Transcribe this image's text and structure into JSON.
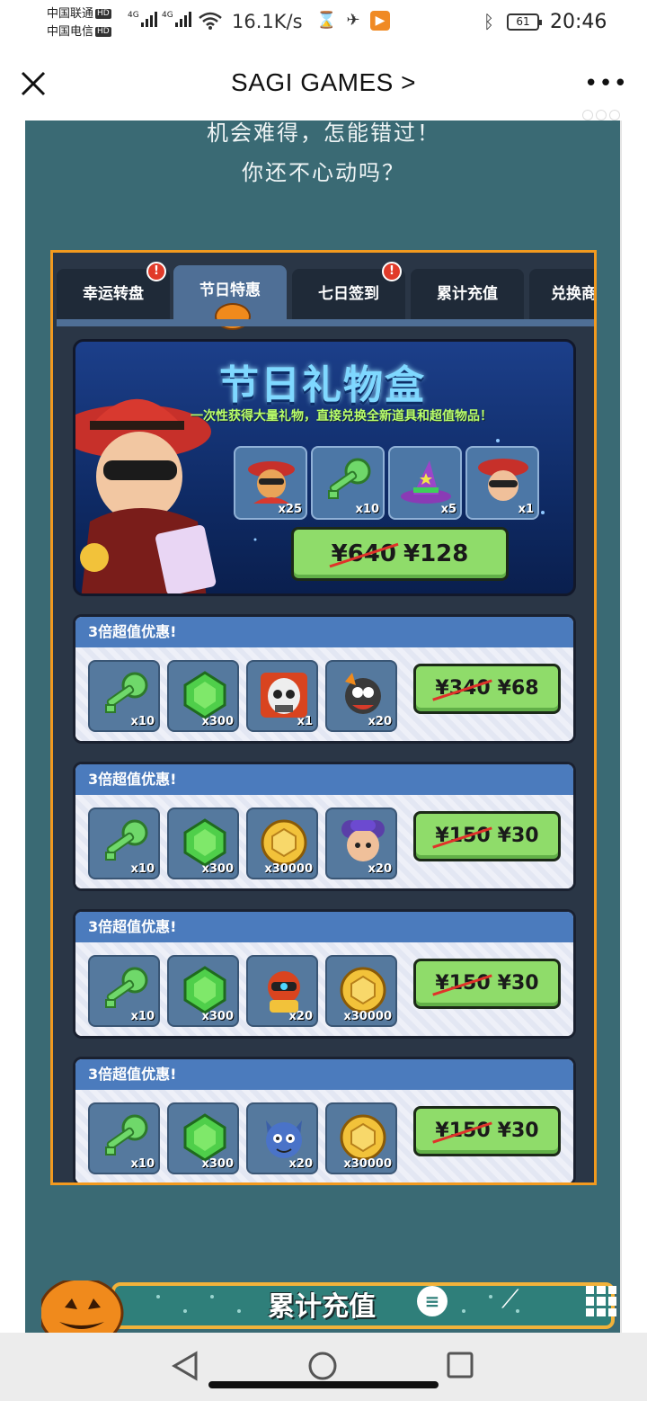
{
  "status_bar": {
    "carrier1": "中国联通",
    "carrier2": "中国电信",
    "hd": "HD",
    "net_type": "4G",
    "net_speed": "16.1K/s",
    "battery": "61",
    "time": "20:46"
  },
  "header": {
    "title": "SAGI GAMES >",
    "more": "•••"
  },
  "promo": {
    "line1": "机会难得，怎能错过！",
    "line2": "你还不心动吗？"
  },
  "tabs": [
    {
      "label": "幸运转盘",
      "badge": "!"
    },
    {
      "label": "节日特惠"
    },
    {
      "label": "七日签到",
      "badge": "!"
    },
    {
      "label": "累计充值"
    },
    {
      "label": "兑换商"
    }
  ],
  "gift_box": {
    "title": "节日礼物盒",
    "subtitle": "一次性获得大量礼物，直接兑换全新道具和超值物品！",
    "items": [
      {
        "icon": "bandit-character-icon",
        "qty": "x25"
      },
      {
        "icon": "green-key-icon",
        "qty": "x10"
      },
      {
        "icon": "witch-hat-icon",
        "qty": "x5"
      },
      {
        "icon": "red-hat-hero-icon",
        "qty": "x1"
      }
    ],
    "old_price": "¥640",
    "price": "¥128"
  },
  "deals": [
    {
      "title": "3倍超值优惠!",
      "items": [
        {
          "icon": "green-key-icon",
          "qty": "x10"
        },
        {
          "icon": "green-gem-icon",
          "qty": "x300"
        },
        {
          "icon": "skull-mask-icon",
          "qty": "x1"
        },
        {
          "icon": "monster-character-icon",
          "qty": "x20"
        }
      ],
      "old_price": "¥340",
      "price": "¥68"
    },
    {
      "title": "3倍超值优惠!",
      "items": [
        {
          "icon": "green-key-icon",
          "qty": "x10"
        },
        {
          "icon": "green-gem-icon",
          "qty": "x300"
        },
        {
          "icon": "gold-coin-icon",
          "qty": "x30000"
        },
        {
          "icon": "purple-mouse-icon",
          "qty": "x20"
        }
      ],
      "old_price": "¥150",
      "price": "¥30"
    },
    {
      "title": "3倍超值优惠!",
      "items": [
        {
          "icon": "green-key-icon",
          "qty": "x10"
        },
        {
          "icon": "green-gem-icon",
          "qty": "x300"
        },
        {
          "icon": "robot-character-icon",
          "qty": "x20"
        },
        {
          "icon": "gold-coin-icon",
          "qty": "x30000"
        }
      ],
      "old_price": "¥150",
      "price": "¥30"
    },
    {
      "title": "3倍超值优惠!",
      "items": [
        {
          "icon": "green-key-icon",
          "qty": "x10"
        },
        {
          "icon": "green-gem-icon",
          "qty": "x300"
        },
        {
          "icon": "blue-cat-icon",
          "qty": "x20"
        },
        {
          "icon": "gold-coin-icon",
          "qty": "x30000"
        }
      ],
      "old_price": "¥150",
      "price": "¥30"
    }
  ],
  "bottom_banner": {
    "label": "累计充值"
  },
  "colors": {
    "page_bg": "#3a6a74",
    "panel_border": "#f29a1f",
    "panel_bg": "#2a3646",
    "tab_active": "#4f6f96",
    "deal_header": "#4b7bbd",
    "price_button": "#8fdc6a",
    "strike": "#e0322a"
  }
}
